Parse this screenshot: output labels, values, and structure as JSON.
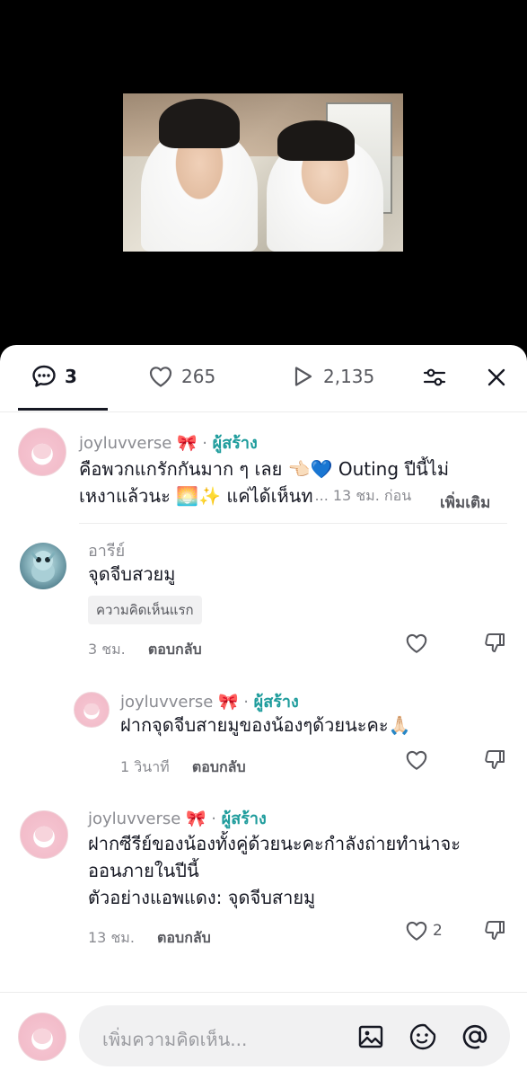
{
  "tabs": {
    "comments_count": "3",
    "likes_count": "265",
    "plays_count": "2,135"
  },
  "comments": [
    {
      "username": "joyluvverse",
      "emoji": "🎀",
      "badge": "ผู้สร้าง",
      "text_line1": "คือพวกแกรักกันมาก ๆ เลย 👈🏻💙 Outing ปีนี้ไม่",
      "text_line2": "เหงาแล้วนะ 🌅✨ แค่ได้เห็นท",
      "time": "... 13 ชม. ก่อน",
      "more": "เพิ่มเติม"
    },
    {
      "username": "อารีย์",
      "text": "จุดจีบสวยมู",
      "tag": "ความคิดเห็นแรก",
      "time": "3 ชม.",
      "reply": "ตอบกลับ",
      "replies": [
        {
          "username": "joyluvverse",
          "emoji": "🎀",
          "badge": "ผู้สร้าง",
          "text": "ฝากจุดจีบสายมูของน้องๆด้วยนะคะ🙏🏻",
          "time": "1 วินาที",
          "reply": "ตอบกลับ"
        }
      ]
    },
    {
      "username": "joyluvverse",
      "emoji": "🎀",
      "badge": "ผู้สร้าง",
      "text_line1": "ฝากซีรีย์ของน้องทั้งคู่ด้วยนะคะกำลังถ่ายทำน่าจะ",
      "text_line2": "ออนภายในปีนี้",
      "text_line3": "ตัวอย่างแอพแดง: จุดจีบสายมู",
      "time": "13 ชม.",
      "reply": "ตอบกลับ",
      "likes": "2"
    }
  ],
  "input": {
    "placeholder": "เพิ่มความคิดเห็น..."
  },
  "colors": {
    "creator_badge": "#1e9c9c",
    "background_top": "#000000",
    "sheet": "#ffffff"
  },
  "icons": [
    "comment-icon",
    "heart-icon",
    "play-icon",
    "filter-icon",
    "close-icon",
    "thumbs-down-icon",
    "image-icon",
    "sticker-icon",
    "at-icon"
  ]
}
